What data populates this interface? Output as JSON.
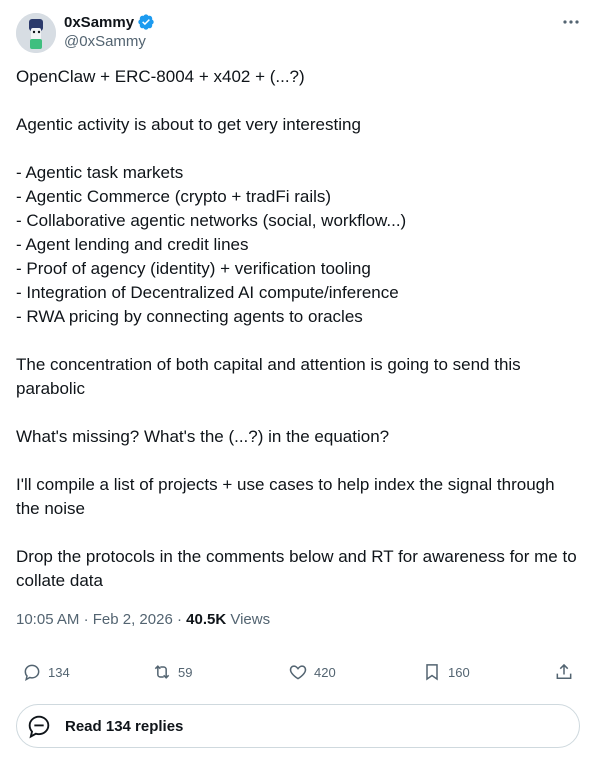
{
  "author": {
    "display_name": "0xSammy",
    "handle": "@0xSammy",
    "verified_color": "#1d9bf0"
  },
  "tweet": {
    "text": "OpenClaw + ERC-8004 + x402 + (...?)\n\nAgentic activity is about to get very interesting\n\n- Agentic task markets\n- Agentic Commerce (crypto + tradFi rails)\n- Collaborative agentic networks (social, workflow...)\n- Agent lending and credit lines\n- Proof of agency (identity) + verification tooling\n- Integration of Decentralized AI compute/inference\n- RWA pricing by connecting agents to oracles\n\nThe concentration of both capital and attention is going to send this parabolic\n\nWhat's missing? What's the (...?) in the equation?\n\nI'll compile a list of projects + use cases to help index the signal through the noise\n\nDrop the protocols in the comments below and RT for awareness for me to collate data"
  },
  "meta": {
    "time": "10:05 AM",
    "date": "Feb 2, 2026",
    "views_count": "40.5K",
    "views_label": "Views"
  },
  "actions": {
    "replies": "134",
    "reposts": "59",
    "likes": "420",
    "bookmarks": "160"
  },
  "read_replies_label": "Read 134 replies",
  "icons": {
    "more": "more-icon",
    "reply": "reply-icon",
    "repost": "repost-icon",
    "like": "like-icon",
    "bookmark": "bookmark-icon",
    "share": "share-icon",
    "read_replies": "chat-bubble-icon"
  }
}
